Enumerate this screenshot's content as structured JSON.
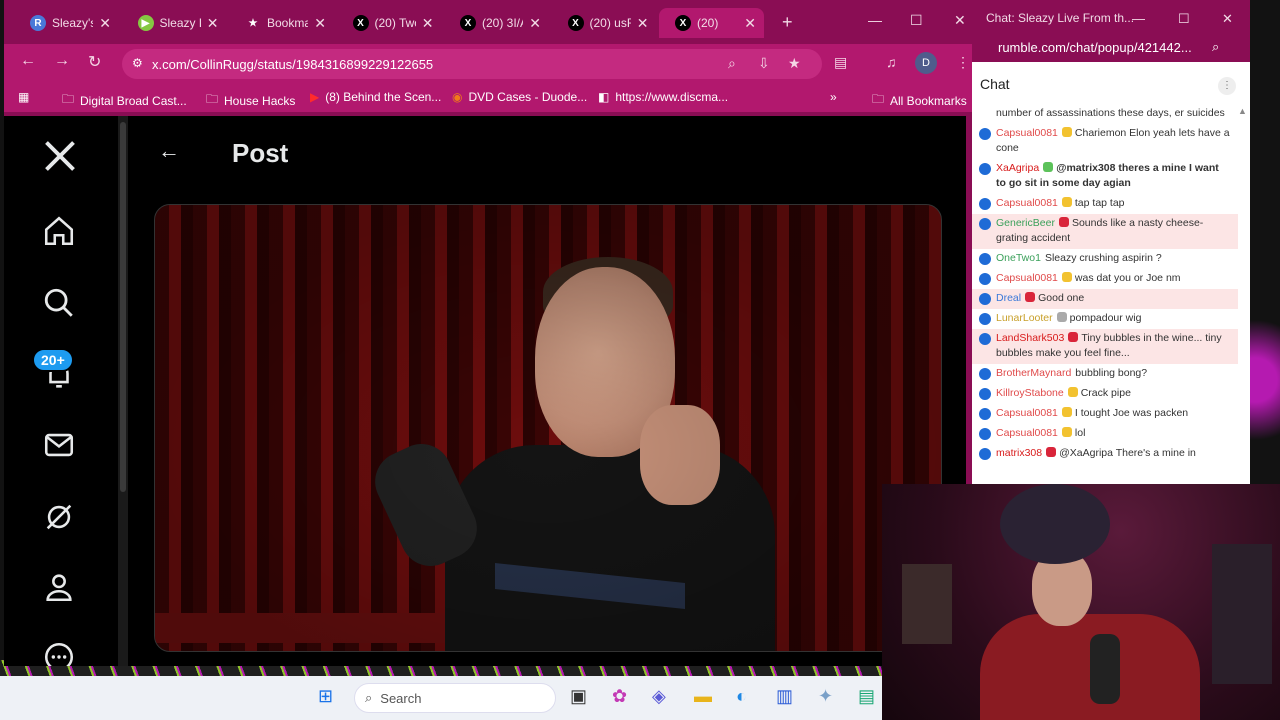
{
  "browser": {
    "tabs": [
      {
        "title": "Sleazy's",
        "fav_letter": "R",
        "fav_color": "#4a79d8"
      },
      {
        "title": "Sleazy Li",
        "fav_letter": "▶",
        "fav_color": "#85c742"
      },
      {
        "title": "Bookma",
        "fav_letter": "★",
        "fav_color": "transparent"
      },
      {
        "title": "(20) Two",
        "fav_letter": "X",
        "fav_color": "#000000"
      },
      {
        "title": "(20) 3I/A",
        "fav_letter": "X",
        "fav_color": "#000000"
      },
      {
        "title": "(20) usR",
        "fav_letter": "X",
        "fav_color": "#000000"
      },
      {
        "title": "(20)",
        "fav_letter": "X",
        "fav_color": "#000000",
        "active": true
      }
    ],
    "url": "x.com/CollinRugg/status/1984316899229122655",
    "profile_initial": "D",
    "bookmarks": [
      {
        "label": "Digital Broad Cast...",
        "icon": "folder-icon"
      },
      {
        "label": "House Hacks",
        "icon": "folder-icon"
      },
      {
        "label": "(8) Behind the Scen...",
        "icon": "youtube-icon"
      },
      {
        "label": "DVD Cases - Duode...",
        "icon": "site-icon"
      },
      {
        "label": "https://www.discma...",
        "icon": "site-icon"
      }
    ],
    "all_bookmarks": "All Bookmarks",
    "more_bookmarks": "»"
  },
  "x": {
    "page_title": "Post",
    "badge": "20+"
  },
  "chat": {
    "window_title": "Chat: Sleazy Live From th...",
    "url": "rumble.com/chat/popup/421442...",
    "header": "Chat",
    "messages": [
      {
        "user": "",
        "text": "number of assassinations these days, er suicides",
        "color": "#333333"
      },
      {
        "user": "Capsual0081",
        "text": "Chariemon Elon yeah lets have a cone",
        "color": "#e04a4a",
        "badge": "#f2c230"
      },
      {
        "user": "XaAgripa",
        "text": "@matrix308 theres a mine I want to go sit in some day agian",
        "color": "#d81b1b",
        "badge": "#5cc25a",
        "bold_text": true
      },
      {
        "user": "Capsual0081",
        "text": "tap tap tap",
        "color": "#e04a4a",
        "badge": "#f2c230"
      },
      {
        "user": "GenericBeer",
        "text": "Sounds like a nasty cheese-grating accident",
        "color": "#3aa05a",
        "badge": "#d9253a",
        "highlight": true
      },
      {
        "user": "OneTwo1",
        "text": "Sleazy crushing aspirin ?",
        "color": "#3aa05a"
      },
      {
        "user": "Capsual0081",
        "text": "was dat you or Joe nm",
        "color": "#e04a4a",
        "badge": "#f2c230"
      },
      {
        "user": "Dreal",
        "text": "Good one",
        "color": "#3a78d8",
        "badge": "#d9253a",
        "highlight": true
      },
      {
        "user": "LunarLooter",
        "text": "pompadour wig",
        "color": "#c8a02a",
        "badge": "#aaaaaa"
      },
      {
        "user": "LandShark503",
        "text": "Tiny bubbles in the wine... tiny bubbles make you feel fine...",
        "color": "#d81b1b",
        "badge": "#d9253a",
        "highlight": true
      },
      {
        "user": "BrotherMaynard",
        "text": "bubbling bong?",
        "color": "#e04a4a"
      },
      {
        "user": "KillroyStabone",
        "text": "Crack pipe",
        "color": "#e04a4a",
        "badge": "#f2c230"
      },
      {
        "user": "Capsual0081",
        "text": "I tought Joe was packen",
        "color": "#e04a4a",
        "badge": "#f2c230"
      },
      {
        "user": "Capsual0081",
        "text": "lol",
        "color": "#e04a4a",
        "badge": "#f2c230"
      },
      {
        "user": "matrix308",
        "text": "@XaAgripa There's a mine in",
        "color": "#d81b1b",
        "badge": "#d9253a"
      }
    ]
  },
  "taskbar": {
    "search_label": "Search"
  }
}
